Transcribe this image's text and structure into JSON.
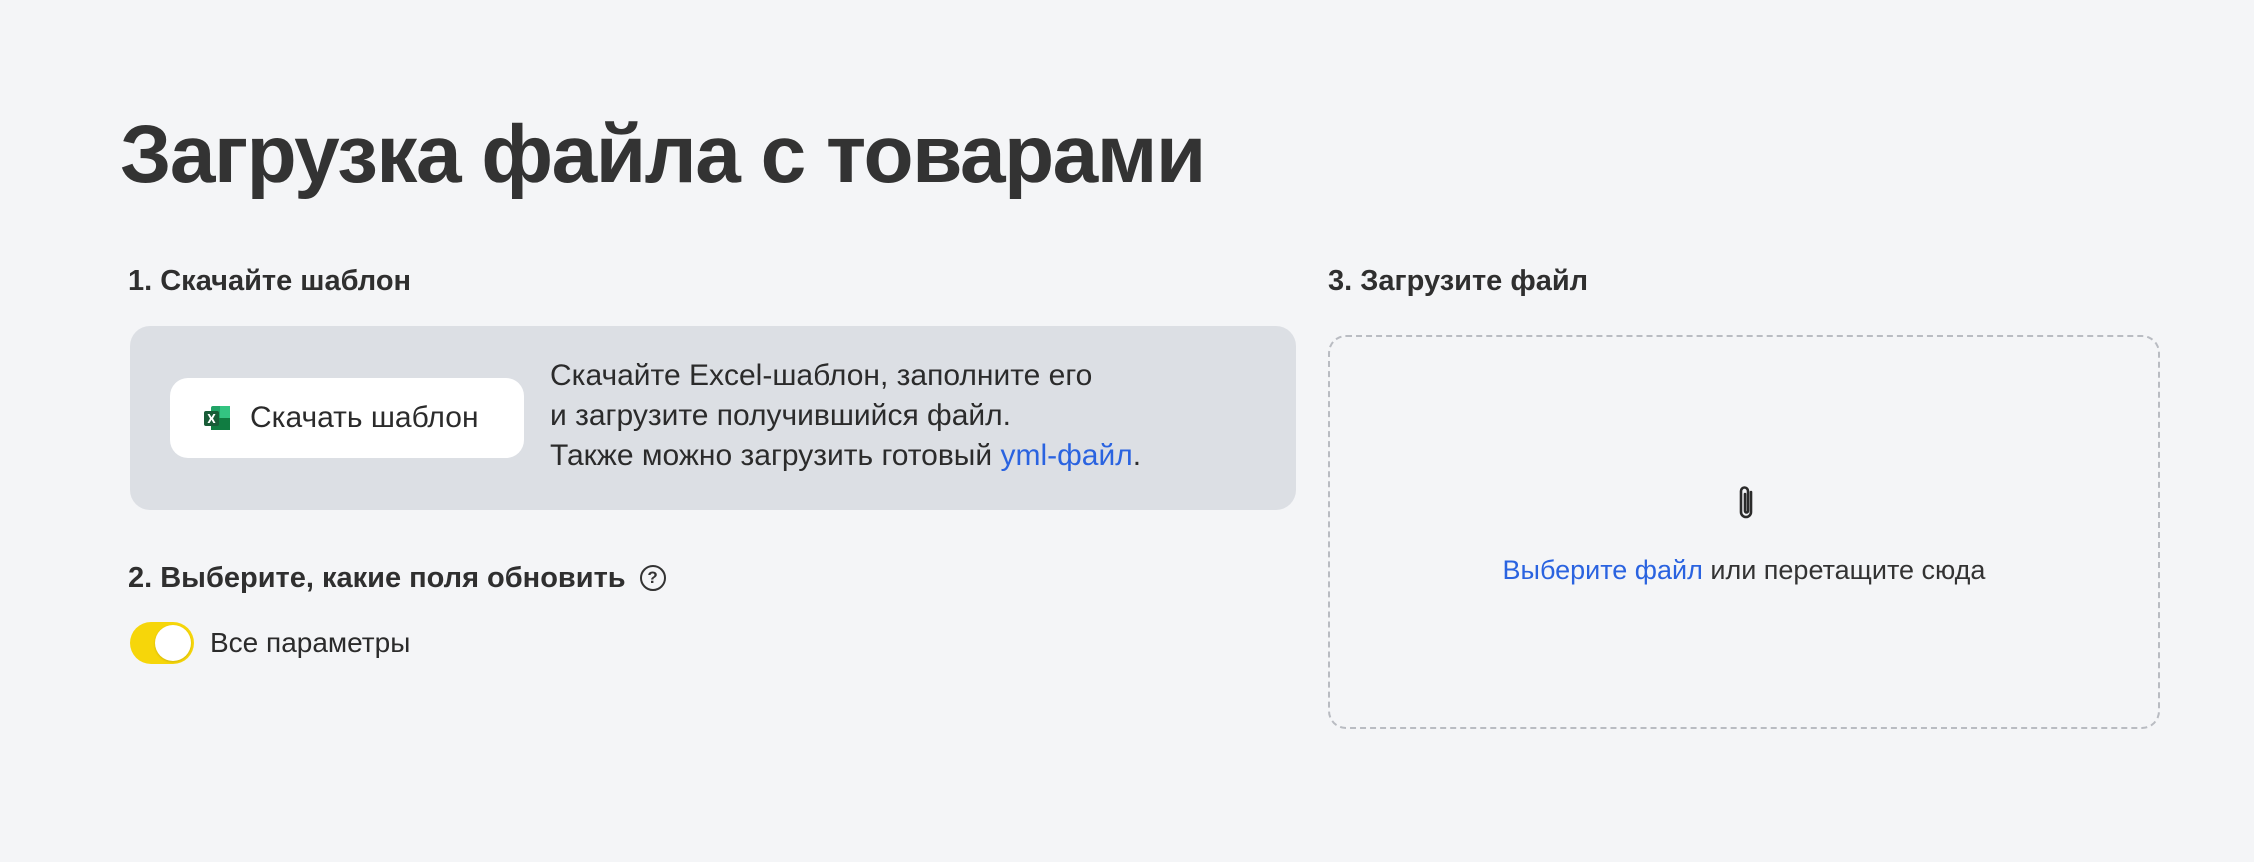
{
  "page": {
    "title": "Загрузка файла с товарами"
  },
  "step1": {
    "title": "1. Скачайте шаблон",
    "button_label": "Скачать шаблон",
    "button_icon": "excel-icon",
    "desc_line1": "Скачайте Excel-шаблон, заполните его",
    "desc_line2": "и загрузите получившийся файл.",
    "desc_line3_prefix": "Также можно загрузить готовый ",
    "desc_link": "yml-файл",
    "desc_line3_suffix": "."
  },
  "step2": {
    "title": "2. Выберите, какие поля обновить",
    "help_icon": "question-circle-icon",
    "help_glyph": "?",
    "toggle_label": "Все параметры",
    "toggle_on": true
  },
  "step3": {
    "title": "3. Загрузите файл",
    "icon": "paperclip-icon",
    "choose_link": "Выберите файл",
    "drop_text": " или перетащите сюда"
  },
  "colors": {
    "background": "#f4f5f7",
    "card": "#dcdfe4",
    "link": "#2a63e0",
    "toggle_on": "#f6d60a",
    "excel_green": "#1f7244"
  }
}
